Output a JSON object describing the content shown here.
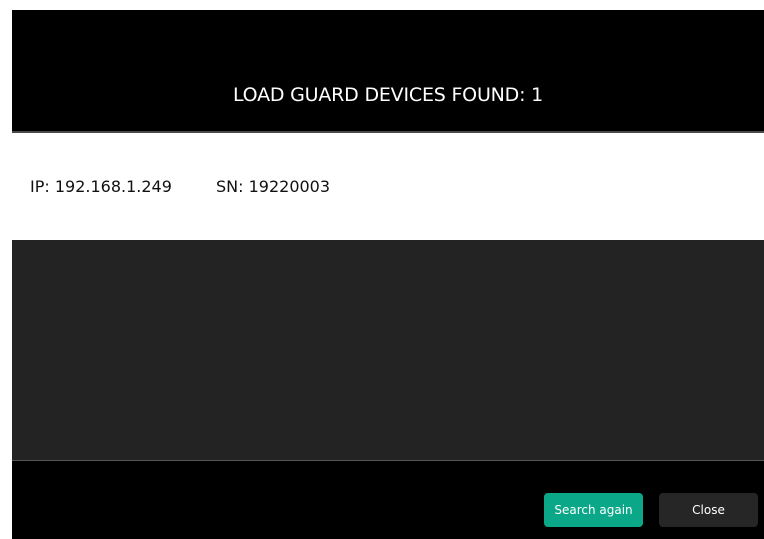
{
  "dialog": {
    "title": "LOAD GUARD DEVICES FOUND: 1",
    "devices": [
      {
        "ip": "IP: 192.168.1.249",
        "sn": "SN: 19220003"
      }
    ],
    "buttons": {
      "search_again": "Search again",
      "close": "Close"
    }
  },
  "colors": {
    "header_bg": "#000000",
    "results_bg": "#ffffff",
    "empty_area_bg": "#232323",
    "primary_button": "#0aa888",
    "secondary_button": "#262626"
  }
}
